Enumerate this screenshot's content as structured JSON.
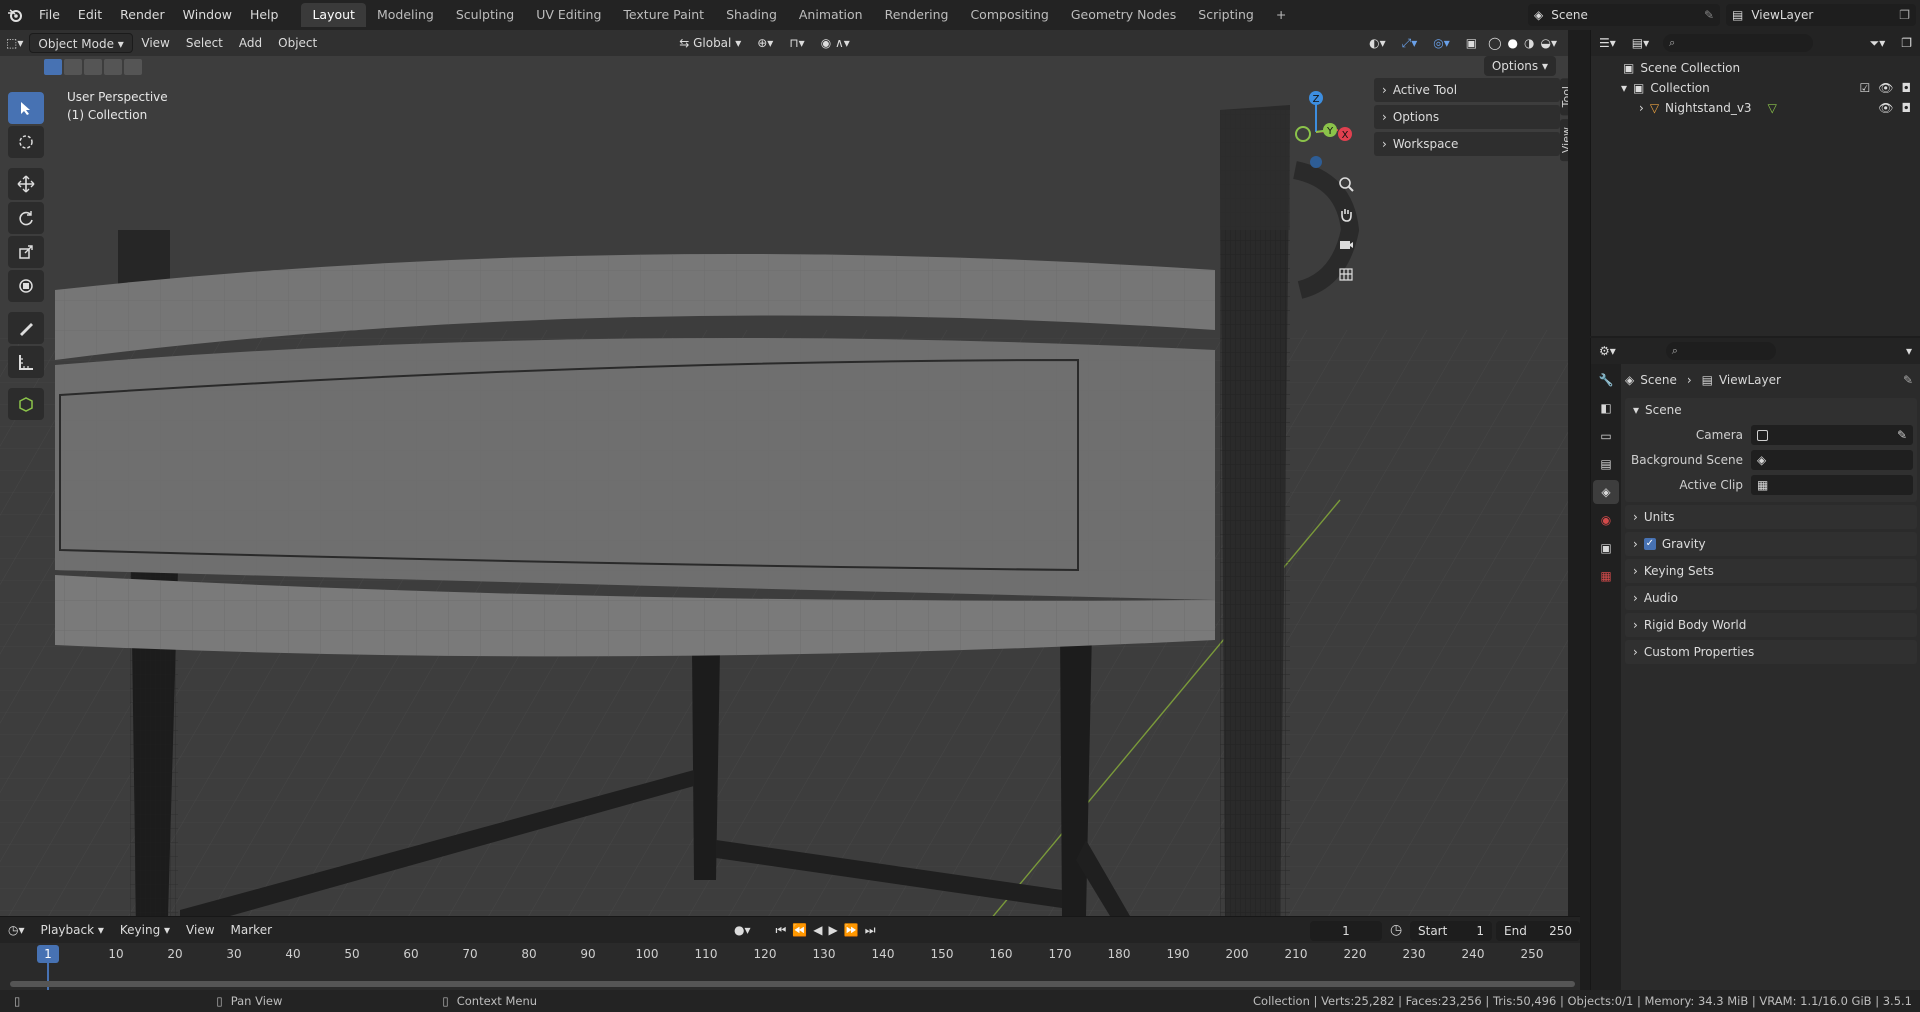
{
  "menu": {
    "items": [
      "File",
      "Edit",
      "Render",
      "Window",
      "Help"
    ]
  },
  "workspaces": {
    "tabs": [
      "Layout",
      "Modeling",
      "Sculpting",
      "UV Editing",
      "Texture Paint",
      "Shading",
      "Animation",
      "Rendering",
      "Compositing",
      "Geometry Nodes",
      "Scripting"
    ],
    "active": "Layout",
    "add": "+"
  },
  "scene_selector": {
    "scene": "Scene",
    "view_layer": "ViewLayer"
  },
  "viewport": {
    "mode": "Object Mode",
    "menus": [
      "View",
      "Select",
      "Add",
      "Object"
    ],
    "transform_orientation": "Global",
    "options": "Options",
    "overlay_line1": "User Perspective",
    "overlay_line2": "(1) Collection",
    "npanel": [
      "Active Tool",
      "Options",
      "Workspace"
    ],
    "npanel_tabs": [
      "Tool",
      "View"
    ],
    "gizmo": {
      "z": "Z",
      "y": "Y",
      "x": "X"
    }
  },
  "timeline": {
    "menus": [
      "Playback",
      "Keying",
      "View",
      "Marker"
    ],
    "current_frame": "1",
    "start_label": "Start",
    "start": "1",
    "end_label": "End",
    "end": "250",
    "ticks": [
      "1",
      "10",
      "20",
      "30",
      "40",
      "50",
      "60",
      "70",
      "80",
      "90",
      "100",
      "110",
      "120",
      "130",
      "140",
      "150",
      "160",
      "170",
      "180",
      "190",
      "200",
      "210",
      "220",
      "230",
      "240",
      "250"
    ]
  },
  "statusbar": {
    "pan": "Pan View",
    "context": "Context Menu",
    "stats": "Collection | Verts:25,282 | Faces:23,256 | Tris:50,496 | Objects:0/1 | Memory: 34.3 MiB | VRAM: 1.1/16.0 GiB | 3.5.1"
  },
  "outliner": {
    "root": "Scene Collection",
    "collection": "Collection",
    "object": "Nightstand_v3"
  },
  "properties": {
    "breadcrumb_scene": "Scene",
    "breadcrumb_layer": "ViewLayer",
    "scene_panel": "Scene",
    "camera_label": "Camera",
    "bg_scene_label": "Background Scene",
    "active_clip_label": "Active Clip",
    "panels": [
      "Units",
      "Gravity",
      "Keying Sets",
      "Audio",
      "Rigid Body World",
      "Custom Properties"
    ]
  },
  "colors": {
    "accent": "#4772b3",
    "axis_x": "#e0404f",
    "axis_y": "#8bc34a",
    "axis_z": "#3d8ee0"
  }
}
